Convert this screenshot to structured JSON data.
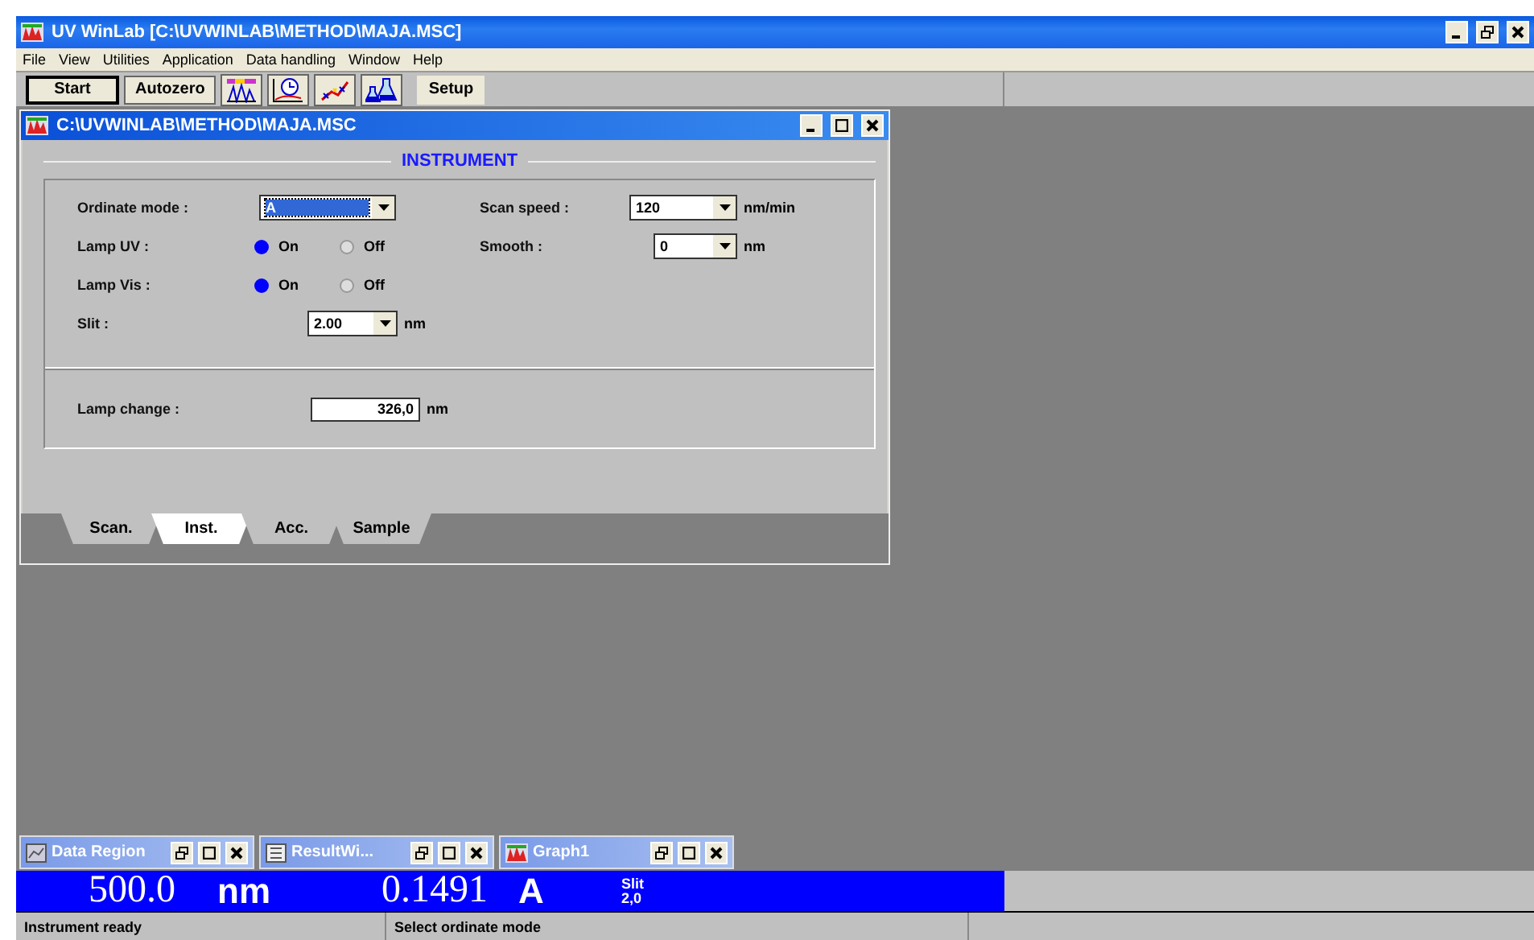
{
  "window": {
    "title": "UV WinLab [C:\\UVWINLAB\\METHOD\\MAJA.MSC]"
  },
  "menu": [
    "File",
    "View",
    "Utilities",
    "Application",
    "Data handling",
    "Window",
    "Help"
  ],
  "toolbar": [
    {
      "kind": "text",
      "label": "Start",
      "pressed": true
    },
    {
      "kind": "text",
      "label": "Autozero",
      "pressed": false
    },
    {
      "kind": "spectrum",
      "pressed": false
    },
    {
      "kind": "timedrive",
      "pressed": false
    },
    {
      "kind": "curve",
      "pressed": false
    },
    {
      "kind": "flasks",
      "pressed": false
    },
    {
      "kind": "flat",
      "label": "Setup",
      "pressed": false
    }
  ],
  "method_window": {
    "title": "C:\\UVWINLAB\\METHOD\\MAJA.MSC",
    "section_title": "INSTRUMENT",
    "ordinate_mode": {
      "label": "Ordinate mode :",
      "value": "A",
      "focused": true
    },
    "lamps": [
      {
        "label": "Lamp UV :",
        "options": [
          {
            "label": "On",
            "selected": true
          },
          {
            "label": "Off",
            "selected": false
          }
        ]
      },
      {
        "label": "Lamp Vis :",
        "options": [
          {
            "label": "On",
            "selected": true
          },
          {
            "label": "Off",
            "selected": false
          }
        ]
      }
    ],
    "slit": {
      "label": "Slit :",
      "value": "2.00",
      "unit": "nm"
    },
    "scan_speed": {
      "label": "Scan speed :",
      "value": "120",
      "unit": "nm/min"
    },
    "smooth": {
      "label": "Smooth :",
      "value": "0",
      "unit": "nm"
    },
    "lamp_change": {
      "label": "Lamp change :",
      "value": "326,0",
      "unit": "nm"
    },
    "tabs": [
      {
        "label": "Scan.",
        "selected": false
      },
      {
        "label": "Inst.",
        "selected": true
      },
      {
        "label": "Acc.",
        "selected": false
      },
      {
        "label": "Sample",
        "selected": false
      }
    ]
  },
  "minimized_windows": [
    {
      "title": "Data Region",
      "kind": "data"
    },
    {
      "title": "ResultWi...",
      "kind": "result"
    },
    {
      "title": "Graph1",
      "kind": "graph"
    }
  ],
  "readout": {
    "wavelength": "500.0",
    "wavelength_unit": "nm",
    "value": "0.1491",
    "value_unit": "A",
    "slit_label": "Slit",
    "slit_value": "2,0"
  },
  "status_bar": [
    "Instrument ready",
    "Select ordinate mode"
  ]
}
